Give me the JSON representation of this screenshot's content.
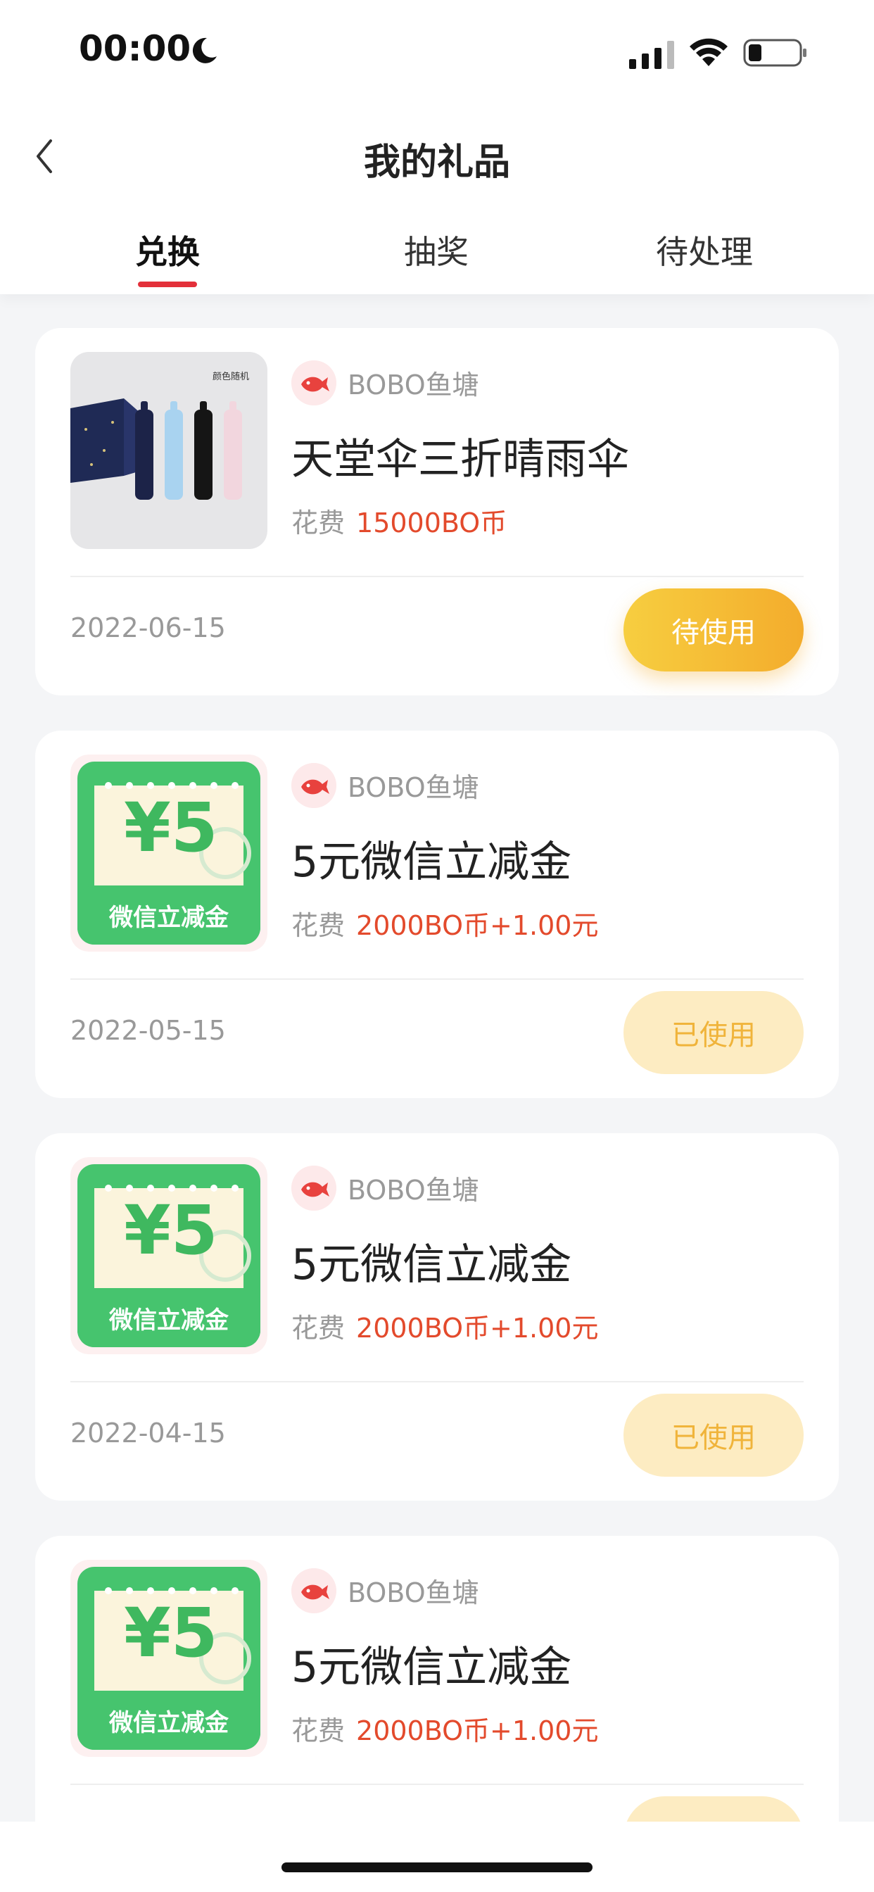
{
  "status_bar": {
    "time": "00:00"
  },
  "header": {
    "title": "我的礼品"
  },
  "tabs": [
    {
      "label": "兑换",
      "active": true
    },
    {
      "label": "抽奖",
      "active": false
    },
    {
      "label": "待处理",
      "active": false
    }
  ],
  "items": [
    {
      "thumb_text": "颜色随机",
      "shop": "BOBO鱼塘",
      "name": "天堂伞三折晴雨伞",
      "price_label": "花费",
      "price": "15000BO币",
      "date": "2022-06-15",
      "status": "待使用"
    },
    {
      "coupon_value": "¥5",
      "coupon_label": "微信立减金",
      "shop": "BOBO鱼塘",
      "name": "5元微信立减金",
      "price_label": "花费",
      "price": "2000BO币+1.00元",
      "date": "2022-05-15",
      "status": "已使用"
    },
    {
      "coupon_value": "¥5",
      "coupon_label": "微信立减金",
      "shop": "BOBO鱼塘",
      "name": "5元微信立减金",
      "price_label": "花费",
      "price": "2000BO币+1.00元",
      "date": "2022-04-15",
      "status": "已使用"
    },
    {
      "coupon_value": "¥5",
      "coupon_label": "微信立减金",
      "shop": "BOBO鱼塘",
      "name": "5元微信立减金",
      "price_label": "花费",
      "price": "2000BO币+1.00元",
      "date": "",
      "status": ""
    }
  ],
  "colors": {
    "accent_red": "#e3303a",
    "price_orange": "#e34a2c",
    "pending_yellow": "#f3ac2c",
    "used_bg": "#fdecc2",
    "coupon_green": "#3fc06a"
  }
}
